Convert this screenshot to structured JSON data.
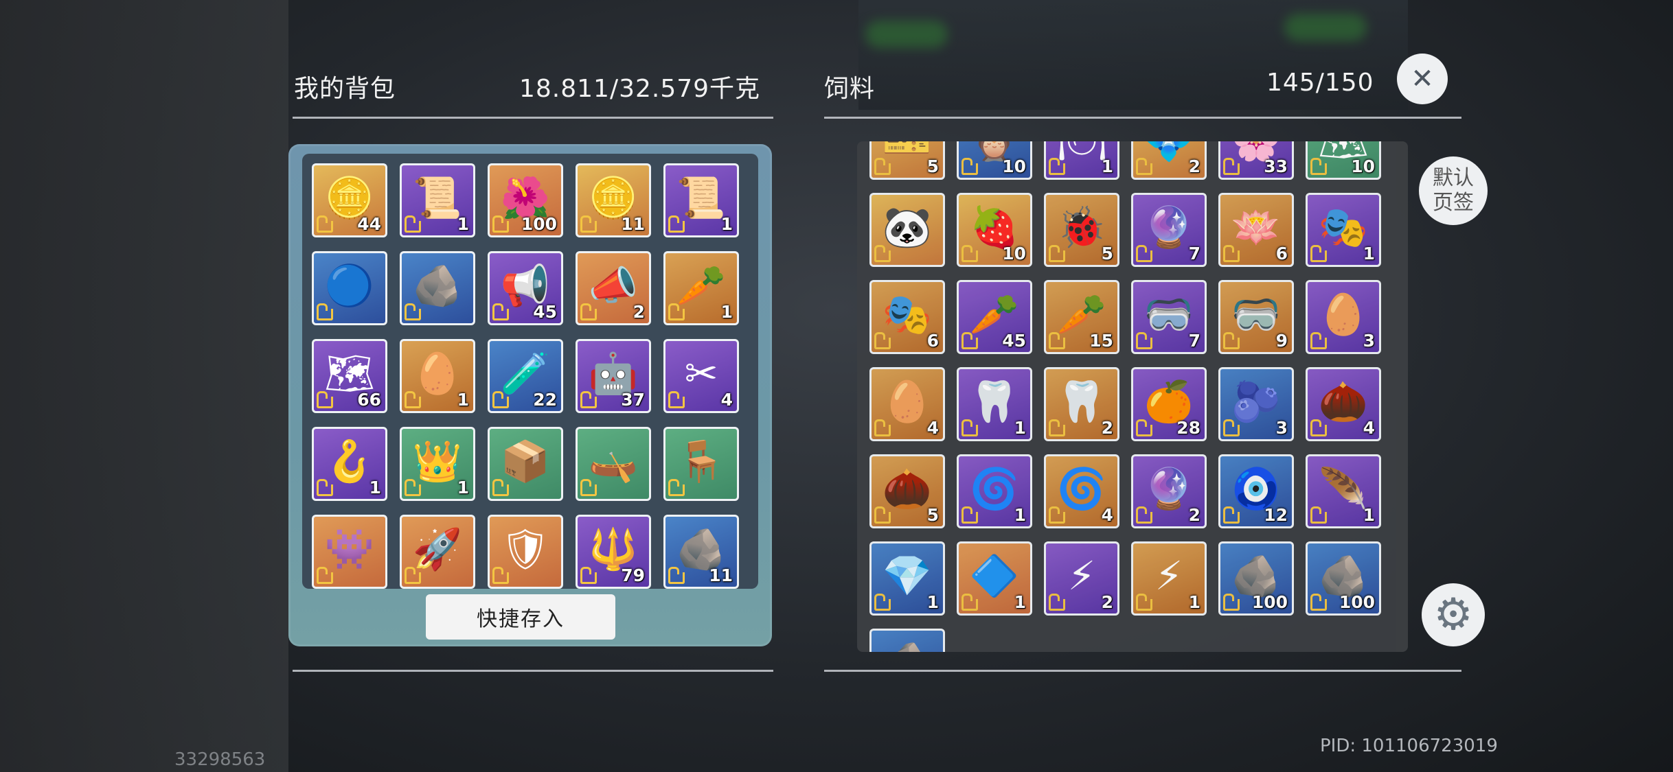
{
  "bag": {
    "title": "我的背包",
    "weight": "18.811/32.579千克",
    "quick_store_label": "快捷存入",
    "items": [
      {
        "icon": "gold-coin-icon",
        "glyph": "🪙",
        "count": "44",
        "color": "gold"
      },
      {
        "icon": "wanted-poster-icon",
        "glyph": "📜",
        "count": "1",
        "color": "purple"
      },
      {
        "icon": "red-flower-icon",
        "glyph": "🌺",
        "count": "100",
        "color": "orange"
      },
      {
        "icon": "gold-coin-icon",
        "glyph": "🪙",
        "count": "11",
        "color": "gold"
      },
      {
        "icon": "wanted-poster-icon",
        "glyph": "📜",
        "count": "1",
        "color": "purple"
      },
      {
        "icon": "portal-mirror-icon",
        "glyph": "🔵",
        "count": "",
        "color": "blue"
      },
      {
        "icon": "grey-stone-icon",
        "glyph": "🪨",
        "count": "",
        "color": "blue"
      },
      {
        "icon": "megaphone-icon",
        "glyph": "📢",
        "count": "45",
        "color": "purple"
      },
      {
        "icon": "gold-megaphone-icon",
        "glyph": "📣",
        "count": "2",
        "color": "orange"
      },
      {
        "icon": "carrot-crystal-icon",
        "glyph": "🥕",
        "count": "1",
        "color": "pink"
      },
      {
        "icon": "treasure-map-icon",
        "glyph": "🗺",
        "count": "66",
        "color": "purple"
      },
      {
        "icon": "egg-crystal-icon",
        "glyph": "🥚",
        "count": "1",
        "color": "pink"
      },
      {
        "icon": "scroll-icon",
        "glyph": "🧪",
        "count": "22",
        "color": "blue"
      },
      {
        "icon": "robot-pet-icon",
        "glyph": "🤖",
        "count": "37",
        "color": "purple"
      },
      {
        "icon": "shears-icon",
        "glyph": "✂",
        "count": "4",
        "color": "purple"
      },
      {
        "icon": "sickle-icon",
        "glyph": "🪝",
        "count": "1",
        "color": "purple"
      },
      {
        "icon": "thorn-crown-icon",
        "glyph": "👑",
        "count": "1",
        "color": "green"
      },
      {
        "icon": "wooden-crate-icon",
        "glyph": "📦",
        "count": "",
        "color": "green"
      },
      {
        "icon": "wooden-boat-icon",
        "glyph": "🛶",
        "count": "",
        "color": "green"
      },
      {
        "icon": "chair-icon",
        "glyph": "🪑",
        "count": "",
        "color": "green"
      },
      {
        "icon": "purple-monster-icon",
        "glyph": "👾",
        "count": "",
        "color": "orange"
      },
      {
        "icon": "spaceship-icon",
        "glyph": "🚀",
        "count": "",
        "color": "orange"
      },
      {
        "icon": "armor-figure-icon",
        "glyph": "🛡",
        "count": "",
        "color": "orange"
      },
      {
        "icon": "trident-icon",
        "glyph": "🔱",
        "count": "79",
        "color": "purple"
      },
      {
        "icon": "ore-rock-icon",
        "glyph": "🪨",
        "count": "11",
        "color": "blue"
      }
    ]
  },
  "feed": {
    "title": "饲料",
    "capacity": "145/150",
    "items": [
      {
        "icon": "ticket-icon",
        "glyph": "🎫",
        "count": "5",
        "color": "gold"
      },
      {
        "icon": "owl-pet-icon",
        "glyph": "🦉",
        "count": "10",
        "color": "blue"
      },
      {
        "icon": "plate-icon",
        "glyph": "🍽",
        "count": "1",
        "color": "purple"
      },
      {
        "icon": "blue-flower-icon",
        "glyph": "💠",
        "count": "2",
        "color": "gold"
      },
      {
        "icon": "pink-flower-icon",
        "glyph": "🌸",
        "count": "33",
        "color": "purple"
      },
      {
        "icon": "map-icon",
        "glyph": "🗺",
        "count": "10",
        "color": "green"
      },
      {
        "icon": "panda-icon",
        "glyph": "🐼",
        "count": "",
        "color": "gold"
      },
      {
        "icon": "berry-icon",
        "glyph": "🍓",
        "count": "10",
        "color": "gold"
      },
      {
        "icon": "bug-crystal-icon",
        "glyph": "🐞",
        "count": "5",
        "color": "pink"
      },
      {
        "icon": "flame-crystal-icon",
        "glyph": "🔮",
        "count": "7",
        "color": "purple"
      },
      {
        "icon": "lotus-crystal-icon",
        "glyph": "🪷",
        "count": "6",
        "color": "pink"
      },
      {
        "icon": "mask-crystal-icon",
        "glyph": "🎭",
        "count": "1",
        "color": "purple"
      },
      {
        "icon": "mask-crystal-icon",
        "glyph": "🎭",
        "count": "6",
        "color": "pink"
      },
      {
        "icon": "carrot-crystal-icon",
        "glyph": "🥕",
        "count": "45",
        "color": "purple"
      },
      {
        "icon": "carrot-crystal-icon",
        "glyph": "🥕",
        "count": "15",
        "color": "pink"
      },
      {
        "icon": "goggles-crystal-icon",
        "glyph": "🥽",
        "count": "7",
        "color": "purple"
      },
      {
        "icon": "goggles-crystal-icon",
        "glyph": "🥽",
        "count": "9",
        "color": "pink"
      },
      {
        "icon": "egg-crystal-icon",
        "glyph": "🥚",
        "count": "3",
        "color": "purple"
      },
      {
        "icon": "egg-crystal-icon",
        "glyph": "🥚",
        "count": "4",
        "color": "pink"
      },
      {
        "icon": "horn-crystal-icon",
        "glyph": "🦷",
        "count": "1",
        "color": "purple"
      },
      {
        "icon": "horn-crystal-icon",
        "glyph": "🦷",
        "count": "2",
        "color": "pink"
      },
      {
        "icon": "citrus-slice-icon",
        "glyph": "🍊",
        "count": "28",
        "color": "purple"
      },
      {
        "icon": "blue-fruit-icon",
        "glyph": "🫐",
        "count": "3",
        "color": "blue"
      },
      {
        "icon": "seed-crystal-icon",
        "glyph": "🌰",
        "count": "4",
        "color": "purple"
      },
      {
        "icon": "seed-crystal-icon",
        "glyph": "🌰",
        "count": "5",
        "color": "pink"
      },
      {
        "icon": "swirl-crystal-icon",
        "glyph": "🌀",
        "count": "1",
        "color": "purple"
      },
      {
        "icon": "swirl-crystal-icon",
        "glyph": "🌀",
        "count": "4",
        "color": "pink"
      },
      {
        "icon": "tusk-crystal-icon",
        "glyph": "🔮",
        "count": "2",
        "color": "purple"
      },
      {
        "icon": "robot-figure-icon",
        "glyph": "🧿",
        "count": "12",
        "color": "blue"
      },
      {
        "icon": "feather-crystal-icon",
        "glyph": "🪶",
        "count": "1",
        "color": "purple"
      },
      {
        "icon": "blue-gem-icon",
        "glyph": "💎",
        "count": "1",
        "color": "blue"
      },
      {
        "icon": "purple-gem-icon",
        "glyph": "🔷",
        "count": "1",
        "color": "orange"
      },
      {
        "icon": "bolt-crystal-icon",
        "glyph": "⚡",
        "count": "2",
        "color": "purple"
      },
      {
        "icon": "bolt-crystal-icon",
        "glyph": "⚡",
        "count": "1",
        "color": "pink"
      },
      {
        "icon": "ore-rock-icon",
        "glyph": "🪨",
        "count": "100",
        "color": "blue"
      },
      {
        "icon": "ore-rock-icon",
        "glyph": "🪨",
        "count": "100",
        "color": "blue"
      },
      {
        "icon": "ore-rock-icon",
        "glyph": "🪨",
        "count": "",
        "color": "blue"
      }
    ]
  },
  "buttons": {
    "close_glyph": "✕",
    "default_tab_label_line1": "默认",
    "default_tab_label_line2": "页签",
    "settings_glyph": "⚙"
  },
  "footer": {
    "pid": "PID: 101106723019",
    "uid": "33298563"
  }
}
